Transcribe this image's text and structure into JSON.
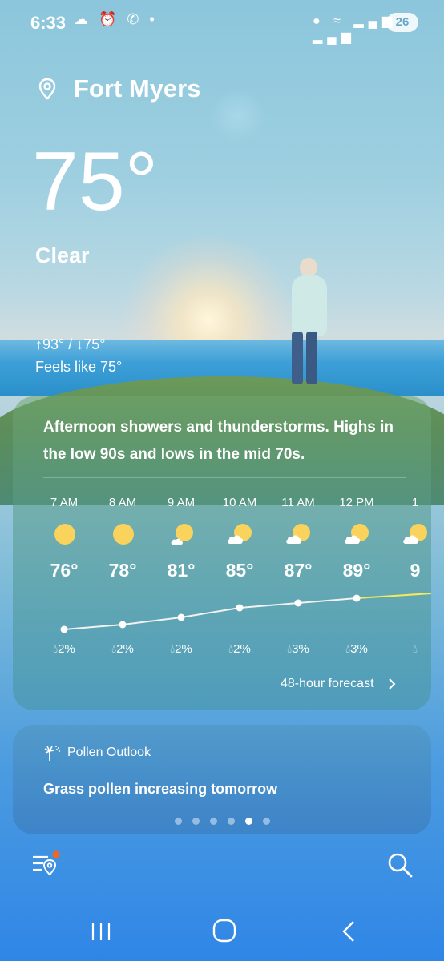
{
  "status_bar": {
    "time": "6:33",
    "left_icons": "☁ ⏰ ✆ •",
    "right_icons": "● ≈ ▂▄▆ ▂▄▆",
    "battery": "26"
  },
  "location": {
    "name": "Fort Myers"
  },
  "current": {
    "temperature": "75°",
    "condition": "Clear",
    "high_low": "↑93° / ↓75°",
    "feels_like": "Feels like 75°"
  },
  "forecast_card": {
    "summary": "Afternoon showers and thunderstorms. Highs in the low 90s and lows in the mid 70s.",
    "more_link": "48-hour forecast",
    "hours": [
      {
        "time": "7 AM",
        "icon": "sunny-icon",
        "temp": "76°",
        "precip": "2%"
      },
      {
        "time": "8 AM",
        "icon": "sunny-icon",
        "temp": "78°",
        "precip": "2%"
      },
      {
        "time": "9 AM",
        "icon": "mostly-sunny-icon",
        "temp": "81°",
        "precip": "2%"
      },
      {
        "time": "10 AM",
        "icon": "partly-cloudy-icon",
        "temp": "85°",
        "precip": "2%"
      },
      {
        "time": "11 AM",
        "icon": "partly-cloudy-icon",
        "temp": "87°",
        "precip": "3%"
      },
      {
        "time": "12 PM",
        "icon": "partly-cloudy-icon",
        "temp": "89°",
        "precip": "3%"
      },
      {
        "time": "1",
        "icon": "partly-cloudy-icon",
        "temp": "9",
        "precip": ""
      }
    ]
  },
  "pollen_card": {
    "title": "Pollen Outlook",
    "message": "Grass pollen increasing tomorrow",
    "page_count": 6,
    "active_page": 5
  },
  "toolbar": {
    "locations_icon": "location-list-icon",
    "search_icon": "search-icon"
  },
  "nav": {
    "recent": "recent-apps-icon",
    "home": "home-icon",
    "back": "back-icon"
  },
  "colors": {
    "accent_dot": "#f26522",
    "sun": "#f9d35c",
    "line_past": "#f2f2f2",
    "line_future": "#f7e95a"
  }
}
